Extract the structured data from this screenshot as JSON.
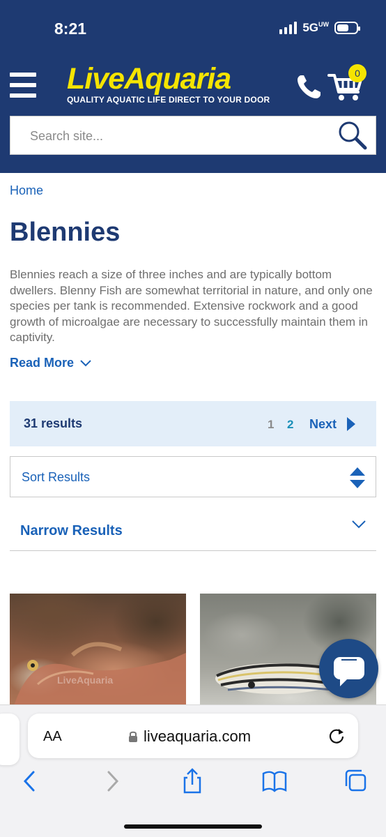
{
  "status_bar": {
    "time": "8:21",
    "network": "5G",
    "network_sub": "UW",
    "battery_level": 0.6
  },
  "header": {
    "brand": "LiveAquaria",
    "tagline": "QUALITY AQUATIC LIFE DIRECT TO YOUR DOOR",
    "cart_count": "0",
    "icons": [
      "menu-icon",
      "phone-icon",
      "cart-icon"
    ],
    "colors": {
      "background": "#1e3a72",
      "logo": "#f5e400"
    }
  },
  "search": {
    "placeholder": "Search site...",
    "icon": "search-icon"
  },
  "breadcrumb": {
    "home": "Home"
  },
  "category": {
    "title": "Blennies",
    "description": "Blennies reach a size of three inches and are typically bottom dwellers. Blenny Fish are somewhat territorial in nature, and only one species per tank is recommended. Extensive rockwork and a good growth of microalgae are necessary to successfully maintain them in captivity.",
    "read_more": "Read More"
  },
  "results": {
    "count_text": "31 results",
    "pages": [
      "1",
      "2"
    ],
    "current_page": "1",
    "next_label": "Next"
  },
  "sort": {
    "label": "Sort Results"
  },
  "filters": {
    "label": "Narrow Results"
  },
  "products": [
    {
      "image_watermark": "LiveAquaria"
    },
    {
      "image_watermark": ""
    }
  ],
  "browser": {
    "text_size_label": "AA",
    "url": "liveaquaria.com",
    "icons": [
      "back-icon",
      "forward-icon",
      "share-icon",
      "bookmarks-icon",
      "tabs-icon",
      "reload-icon",
      "lock-icon"
    ]
  }
}
